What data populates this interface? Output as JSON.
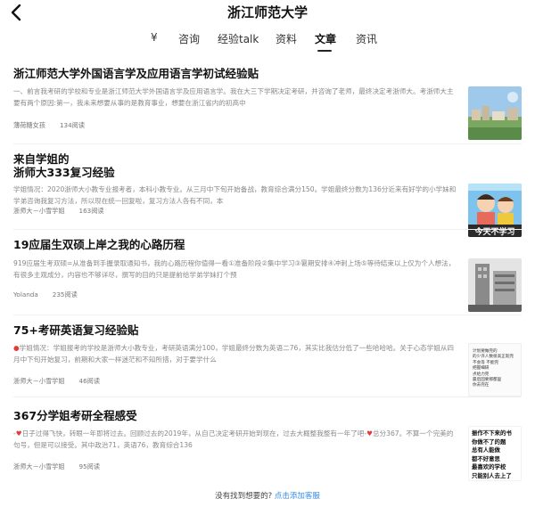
{
  "header": {
    "title": "浙江师范大学",
    "back_label": "返回"
  },
  "tabs": [
    {
      "label": "¥",
      "active": false
    },
    {
      "label": "咨询",
      "active": false
    },
    {
      "label": "经验talk",
      "active": false
    },
    {
      "label": "资料",
      "active": false
    },
    {
      "label": "文章",
      "active": true
    },
    {
      "label": "资讯",
      "active": false
    }
  ],
  "articles": [
    {
      "title": "浙江师范大学外国语言学及应用语言学初试经验贴",
      "excerpt": "一、前言我考研的学校和专业是浙江师范大学外国语言学及应用语言学。我在大三下学期决定考研，并咨询了老师，最终决定考浙师大。考浙师大主要有两个原因:第一，我未来想要从事的是教育事业，想要在浙江省内的初高中",
      "author": "薄荷糖女孩",
      "reads": "134阅读",
      "thumb": "campus-photo"
    },
    {
      "title_line1": "来自学姐的",
      "title_line2": "浙师大333复习经验",
      "excerpt": "学姐情况：2020浙师大小教专业报考者，本科小教专业。从三月中下旬开始备战，教育综合满分150。学姐最终分数为136分近来有好学的小学妹和学弟咨询我复习方法，所以现在统一回复啦，复习方法人各有不同，本",
      "author": "浙师大－小雪学姐",
      "reads": "163阅读",
      "thumb_caption": "今天不学习"
    },
    {
      "title": "19应届生双硕上岸之我的心路历程",
      "excerpt": "919应届生考双硕=从准备到手握录取通知书，我的心路历程你值得一看①准备阶段②集中学习③暑期安排④冲刺上场⑤等待结束以上仅为个人想法，有很多主观成分，内容也不够详尽，撰写的目的只是提前给学弟学妹打个预",
      "author": "Yolanda",
      "reads": "235阅读",
      "thumb": "building-photo"
    },
    {
      "title": "75+考研英语复习经验贴",
      "excerpt": "学姐情况：学姐报考的学校是浙师大小教专业，考研英语满分100，学姐最终分数为英语二76，其实比我估分低了一些哈哈哈。关于心态学姐从四月中下旬开始复习，前期和大家一样迷茫和不知所措，对于要学什么",
      "author": "浙师大－小雪学姐",
      "reads": "46阅读",
      "thumb_lines": [
        "计划要做完的",
        "的少许人数很高正就完",
        "不会等 不能完",
        "把握细研",
        "点给力完",
        "最后固要那都里",
        "你去完在"
      ]
    },
    {
      "title": "367分学姐考研全程感受",
      "excerpt_prefix": "日子过得飞快，转眼一年即将过去。回顾过去的2019年，从自己决定考研开始到现在，过去大概整我整有一年了吧-",
      "excerpt_suffix": "总分367。不算一个完美的句号，但是可以接受。其中政治71，英语76，教育综合136",
      "author": "浙师大－小雪学姐",
      "reads": "95阅读",
      "thumb_lines": [
        "振作不下来的书",
        "你做不了的题",
        "总有人能做",
        "都不好意思",
        "最喜欢的学校",
        "只能别人去上了"
      ]
    }
  ],
  "footer": {
    "text": "没有找到想要的?",
    "link": "点击添加客服"
  },
  "colors": {
    "accent_link": "#3a8ee6",
    "heart": "#e23b3b"
  }
}
